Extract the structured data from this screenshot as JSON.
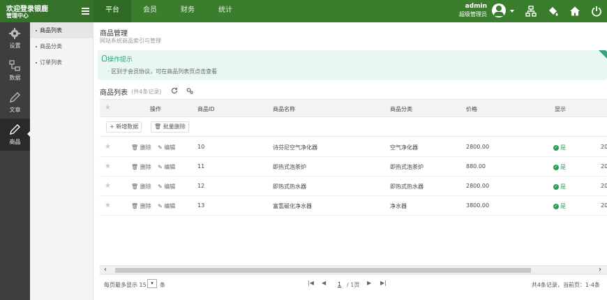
{
  "brand": {
    "line1": "欢迎登录银鹿",
    "line2": "管理中心"
  },
  "top_tabs": [
    "平台",
    "会员",
    "财务",
    "统计"
  ],
  "active_tab": "平台",
  "admin": {
    "name": "admin",
    "role": "超级管理员"
  },
  "top_icons": [
    "sitemap-icon",
    "paint-bucket-icon",
    "home-icon",
    "power-icon"
  ],
  "sidebar": [
    {
      "label": "设置",
      "icon": "gear-icon"
    },
    {
      "label": "数据",
      "icon": "data-icon"
    },
    {
      "label": "文章",
      "icon": "pen-icon"
    },
    {
      "label": "商品",
      "icon": "pen-icon",
      "active": true
    }
  ],
  "subnav": [
    "商品列表",
    "商品分类",
    "订单列表"
  ],
  "page": {
    "title": "商品管理",
    "subtitle": "网站系统商品索引与管理"
  },
  "tips": {
    "title": "操作提示",
    "text": "区别于会员协议，可在商品列表页点击查看"
  },
  "list": {
    "title": "商品列表",
    "count": "(共4条记录)"
  },
  "table": {
    "headers": [
      "操作",
      "商品ID",
      "商品名称",
      "商品分类",
      "价格",
      "显示"
    ],
    "toolbar": {
      "add": "新增数据",
      "bulk_delete": "批量删除"
    },
    "delete_label": "删除",
    "edit_label": "编辑",
    "rows": [
      {
        "id": "10",
        "name": "诗芬尼空气净化器",
        "category": "空气净化器",
        "price": "2800.00",
        "shown": "是",
        "cut": "20"
      },
      {
        "id": "11",
        "name": "即热式泡茶炉",
        "category": "即热式泡茶炉",
        "price": "880.00",
        "shown": "是",
        "cut": "20"
      },
      {
        "id": "12",
        "name": "即热式热水器",
        "category": "即热式热水器",
        "price": "2800.00",
        "shown": "是",
        "cut": "20"
      },
      {
        "id": "13",
        "name": "富氢磁化净水器",
        "category": "净水器",
        "price": "3800.00",
        "shown": "是",
        "cut": "20"
      }
    ]
  },
  "pager": {
    "per_page_label": "每页最多显示",
    "per_page_value": "15",
    "unit": "条",
    "page": "1",
    "total_pages": "/ 1页",
    "info": "共4条记录，当前页：1-4条"
  },
  "colors": {
    "header_green": "#3a7d2c",
    "sidebar_dark": "#3e3e3e",
    "tips_bg": "#e9f7f2",
    "ok_green": "#2a9b55"
  }
}
